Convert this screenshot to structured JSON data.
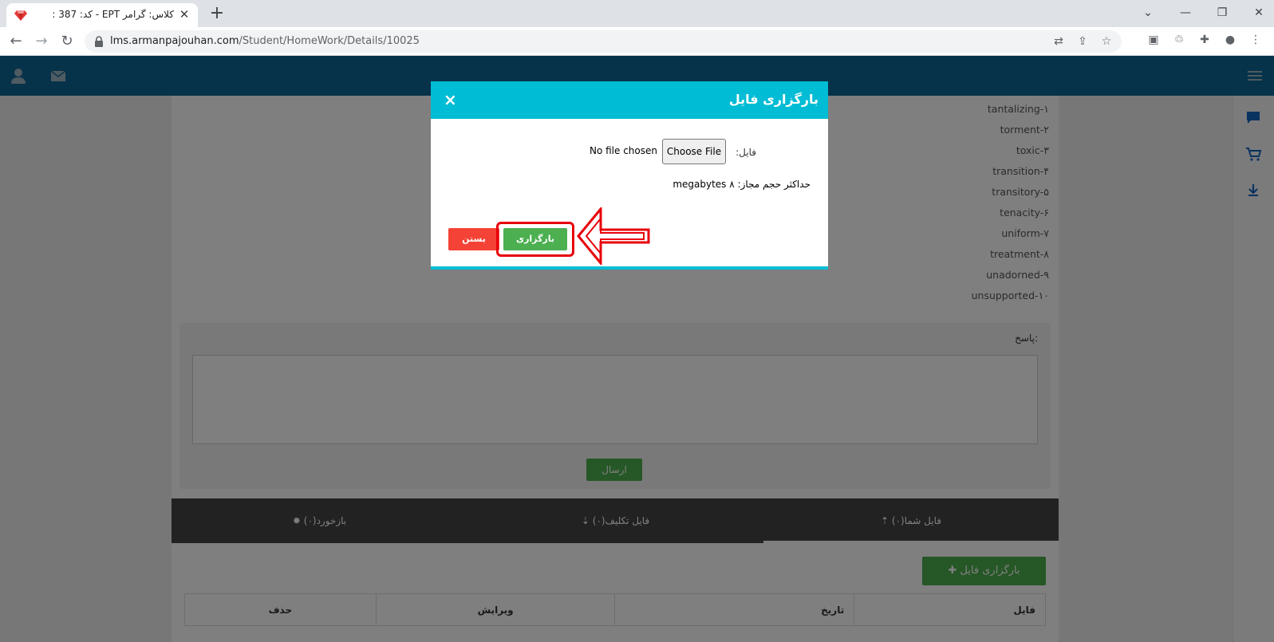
{
  "browser": {
    "tab_title": "کلاس: گرامر EPT - کد: 387 :",
    "url_host": "lms.armanpajouhan.com",
    "url_path": "/Student/HomeWork/Details/10025",
    "icons": [
      "ruby-favicon",
      "close-icon",
      "plus-icon",
      "back-icon",
      "forward-icon",
      "reload-icon",
      "lock-icon",
      "translate-icon",
      "share-icon",
      "star-icon",
      "extension-icon",
      "recycle-icon",
      "puzzle-icon",
      "profile-icon",
      "menu-icon"
    ]
  },
  "words": [
    "tantalizing-۱",
    "torment-۲",
    "toxic-۳",
    "transition-۴",
    "transitory-۵",
    "tenacity-۶",
    "uniform-۷",
    "treatment-۸",
    "unadorned-۹",
    "unsupported-۱۰"
  ],
  "answer": {
    "label": "پاسخ:",
    "send_label": "ارسال"
  },
  "tabs": {
    "my_files": "فایل شما(۰)",
    "assignment_files": "فایل تکلیف(۰)",
    "feedback": "بازخورد(۰)"
  },
  "files": {
    "upload_button": "بارگزاری فایل",
    "columns": [
      "فایل",
      "تاریخ",
      "ویرایش",
      "حذف"
    ]
  },
  "modal": {
    "title": "بارگزاری فایل",
    "close_glyph": "×",
    "file_label": "فایل:",
    "choose_file": "Choose File",
    "no_file": "No file chosen",
    "max_size": "حداکثر حجم مجاز: ۸ megabytes",
    "close_button": "بستن",
    "upload_button": "بارگزاری"
  },
  "colors": {
    "header_blue": "#0e6694",
    "modal_cyan": "#00bcd4",
    "green": "#4caf50",
    "red": "#f44336",
    "annotation_red": "#e8000b"
  }
}
